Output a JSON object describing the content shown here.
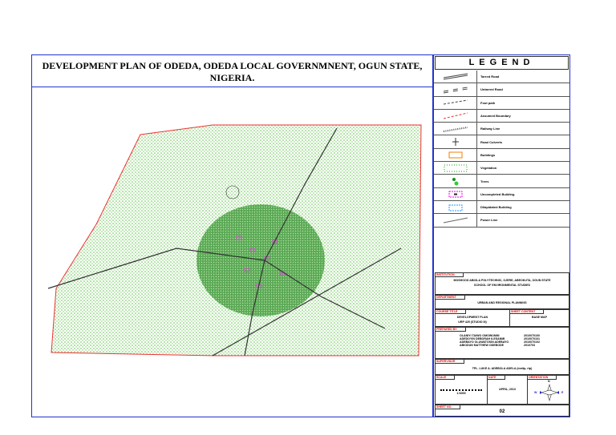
{
  "title": {
    "line1": "DEVELOPMENT PLAN OF ODEDA, ODEDA LOCAL GOVERNMNENT, OGUN STATE,",
    "line2": "NIGERIA."
  },
  "legend": {
    "title": "LEGEND",
    "items": [
      {
        "label": "Tarred Road",
        "icon": "double-line-icon"
      },
      {
        "label": "Untarred Road",
        "icon": "dashed-double-line-icon"
      },
      {
        "label": "Foot path",
        "icon": "dashed-line-icon"
      },
      {
        "label": "Assumed Boundary",
        "icon": "red-dashed-line-icon"
      },
      {
        "label": "Railway Line",
        "icon": "railway-icon"
      },
      {
        "label": "Road Culverts",
        "icon": "culvert-icon"
      },
      {
        "label": "Buildings",
        "icon": "building-icon"
      },
      {
        "label": "Vegetation",
        "icon": "vegetation-icon"
      },
      {
        "label": "Trees",
        "icon": "tree-icon"
      },
      {
        "label": "Uncompleted Building",
        "icon": "uncompleted-building-icon"
      },
      {
        "label": "Dilapidated Building",
        "icon": "dilapidated-building-icon"
      },
      {
        "label": "Power Line",
        "icon": "power-line-icon"
      }
    ]
  },
  "titleblock": {
    "institution_label": "INSTITUTION",
    "institution": "MOSHOOD ABIOLA POLYTECHNIC, OJERE, ABEOKUTA, OGUN STATE",
    "school": "SCHOOL OF ENVIRONMENTAL STUDIES",
    "department_label": "DEPARTMENT",
    "department": "URBAN AND REGIONAL PLANNING",
    "course_label": "COURSE TITLE",
    "course1": "DEVELOPMENT PLAN",
    "course2": "URP 425 (STUDIO III)",
    "sheet_content_label": "SHEET CONTENT",
    "sheet_content": "BASE MAP",
    "prepared_label": "PREPARED BY",
    "preparers": [
      {
        "name": "OLANIYI TAIWO OMOWUNMI",
        "id": "2010070100"
      },
      {
        "name": "ADEDOYIN DEBORAH ILESANMI",
        "id": "2010070101"
      },
      {
        "name": "ADEBAYO OLUWATOSIN ADEBAYO",
        "id": "2010070102"
      },
      {
        "name": "ABIODUN MATTHEW ODEBODE",
        "id": "2010703"
      }
    ],
    "supervisor_label": "SUPERVISOR",
    "supervisor": "TPL. LUKE A. ADEBOLA ADELA (mnitp, rtp)",
    "scale_label": "SCALE",
    "scale": "1:6000",
    "date_label": "DATE",
    "date": "APRIL, 2013",
    "orientation_label": "ORIENTATION",
    "north": "N",
    "east": "E",
    "west": "W",
    "sheet_no_label": "SHEET NO.",
    "sheet_no": "02"
  }
}
